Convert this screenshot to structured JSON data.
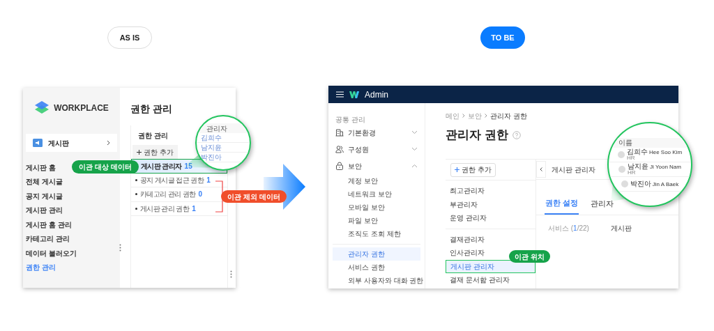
{
  "labels": [
    {
      "text": "AS IS",
      "selected": false
    },
    {
      "text": "TO BE",
      "selected": true
    }
  ],
  "as_is": {
    "logo": "WORKPLACE",
    "board_card": "게시판",
    "menu": [
      {
        "label": "게시판 홈",
        "selected": false
      },
      {
        "label": "전체 게시글",
        "selected": false
      },
      {
        "label": "공지 게시글",
        "selected": false
      },
      {
        "label": "게시판 관리",
        "selected": false
      },
      {
        "label": "게시판 홈 관리",
        "selected": false
      },
      {
        "label": "카테고리 관리",
        "selected": false
      },
      {
        "label": "데이터 불러오기",
        "selected": false
      },
      {
        "label": "권한 관리",
        "selected": true
      }
    ],
    "title": "권한 관리",
    "panel_title": "권한 관리",
    "add_button": "권한 추가",
    "roles": [
      {
        "name": "게시판 관리자",
        "count": "15",
        "selected": true
      },
      {
        "name": "공지 게시글 접근 권한",
        "count": "1",
        "selected": false
      },
      {
        "name": "카테고리 관리 권한",
        "count": "0",
        "selected": false
      },
      {
        "name": "게시판 관리 권한",
        "count": "1",
        "selected": false
      }
    ],
    "magnifier": {
      "header": "관리자",
      "rows": [
        "김희수",
        "남지윤",
        "박진아"
      ]
    },
    "callouts": [
      {
        "kind": "migrate",
        "text": "이관 대상 데이터"
      },
      {
        "kind": "exclude",
        "text": "이관 제외 데이터"
      }
    ]
  },
  "to_be": {
    "app_title": "Admin",
    "sidebar": {
      "section": "공통 관리",
      "groups": [
        {
          "label": "기본환경",
          "expanded": false
        },
        {
          "label": "구성원",
          "expanded": false
        },
        {
          "label": "보안",
          "expanded": true,
          "sections": [
            [
              {
                "label": "계정 보안",
                "selected": false
              },
              {
                "label": "네트워크 보안",
                "selected": false
              },
              {
                "label": "모바일 보안",
                "selected": false
              },
              {
                "label": "파일 보안",
                "selected": false
              },
              {
                "label": "조직도 조회 제한",
                "selected": false
              }
            ],
            [
              {
                "label": "관리자 권한",
                "selected": true
              },
              {
                "label": "서비스 권한",
                "selected": false
              },
              {
                "label": "외부 사용자와 대화 권한",
                "selected": false
              }
            ]
          ]
        }
      ]
    },
    "breadcrumb": [
      "메인",
      "보안",
      "관리자 권한"
    ],
    "title": "관리자 권한",
    "add_button": "권한 추가",
    "role_sections": [
      [
        {
          "name": "최고관리자",
          "selected": false
        },
        {
          "name": "부관리자",
          "selected": false
        },
        {
          "name": "운영 관리자",
          "selected": false
        }
      ],
      [
        {
          "name": "결재관리자",
          "selected": false
        },
        {
          "name": "인사관리자",
          "selected": false
        },
        {
          "name": "게시판 관리자",
          "selected": true
        },
        {
          "name": "결재 문서함 관리자",
          "selected": false
        }
      ]
    ],
    "detail": {
      "title": "게시판 관리자",
      "tabs": [
        {
          "label": "권한 설정",
          "selected": true
        },
        {
          "label": "관리자",
          "selected": false
        }
      ],
      "field": {
        "label_start": "서비스 (",
        "count": "1",
        "label_end": "/22)",
        "value": "게시판"
      }
    },
    "magnifier": {
      "header": "이름",
      "rows": [
        {
          "name": "김희수",
          "name_en": "Hee Soo Kim",
          "dept": "HR"
        },
        {
          "name": "남지윤",
          "name_en": "Ji Yoon Nam",
          "dept": "HR"
        },
        {
          "name": "박진아",
          "name_en": "Jin A Baek"
        }
      ]
    },
    "callout": "이관 위치"
  }
}
